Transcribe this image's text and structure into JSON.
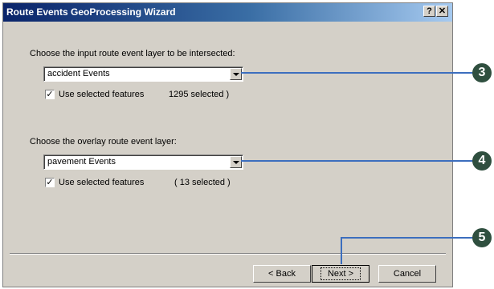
{
  "window": {
    "title": "Route Events GeoProcessing Wizard",
    "help_label": "?",
    "close_label": "✕"
  },
  "input_section": {
    "prompt": "Choose the input route event layer to be intersected:",
    "selected_layer": "accident Events",
    "checkbox_label": "Use selected features",
    "checkbox_checked": true,
    "selection_count": "1295 selected )"
  },
  "overlay_section": {
    "prompt": "Choose the overlay route event layer:",
    "selected_layer": "pavement Events",
    "checkbox_label": "Use selected features",
    "checkbox_checked": true,
    "selection_count": "( 13 selected )"
  },
  "buttons": {
    "back": "< Back",
    "next": "Next >",
    "cancel": "Cancel"
  },
  "callouts": {
    "input_combo": "3",
    "overlay_combo": "4",
    "next_button": "5",
    "color": "#3c6ebe"
  },
  "checkmark": "✓"
}
